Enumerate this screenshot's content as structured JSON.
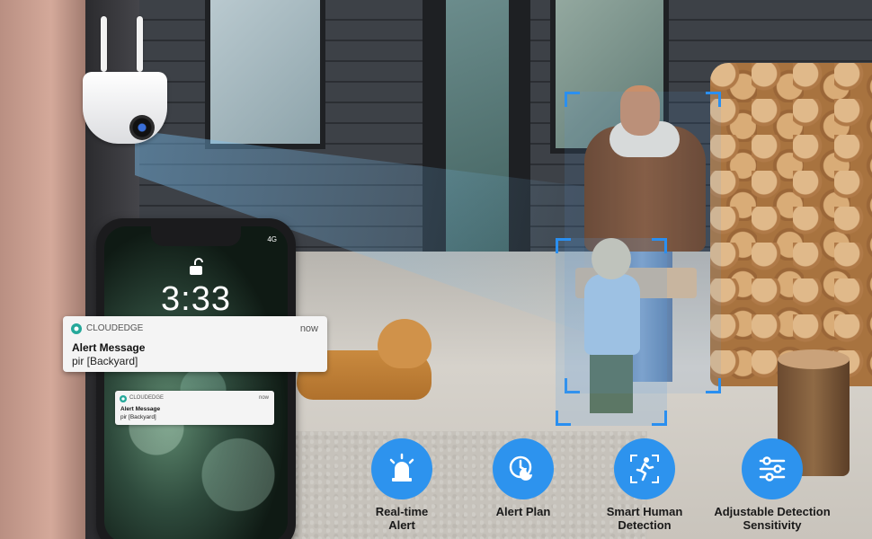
{
  "notification": {
    "app_name": "CLOUDEDGE",
    "time": "now",
    "title": "Alert Message",
    "body": "pir [Backyard]"
  },
  "phone": {
    "clock": "3:33",
    "signal": "4G"
  },
  "features": [
    {
      "label_line1": "Real-time",
      "label_line2": "Alert",
      "icon": "siren-icon"
    },
    {
      "label_line1": "Alert Plan",
      "label_line2": "",
      "icon": "clock-moon-icon"
    },
    {
      "label_line1": "Smart Human",
      "label_line2": "Detection",
      "icon": "running-person-icon"
    },
    {
      "label_line1": "Adjustable Detection",
      "label_line2": "Sensitivity",
      "icon": "sliders-icon"
    }
  ],
  "colors": {
    "accent": "#2d93ee",
    "detection_box": "#2a8ff0"
  }
}
